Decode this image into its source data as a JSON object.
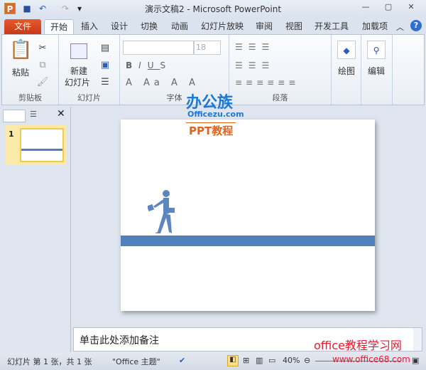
{
  "window": {
    "title": "演示文稿2 - Microsoft PowerPoint"
  },
  "quick_access": {
    "icons": [
      "powerpoint-icon",
      "save-icon",
      "undo-icon",
      "redo-icon",
      "customize-icon"
    ]
  },
  "tabs": [
    {
      "label": "文件"
    },
    {
      "label": "开始"
    },
    {
      "label": "插入"
    },
    {
      "label": "设计"
    },
    {
      "label": "切换"
    },
    {
      "label": "动画"
    },
    {
      "label": "幻灯片放映"
    },
    {
      "label": "审阅"
    },
    {
      "label": "视图"
    },
    {
      "label": "开发工具"
    },
    {
      "label": "加载项"
    }
  ],
  "ribbon": {
    "clipboard": {
      "label": "剪贴板",
      "paste": "粘贴"
    },
    "slides": {
      "label": "幻灯片",
      "new_line1": "新建",
      "new_line2": "幻灯片"
    },
    "font": {
      "label": "字体",
      "font_name": "",
      "font_size": "18"
    },
    "paragraph": {
      "label": "段落"
    },
    "drawing": {
      "label": "绘图"
    },
    "editing": {
      "label": "编辑"
    }
  },
  "slide_panel": {
    "slide_number": "1"
  },
  "watermarks": {
    "top_logo": "办公族",
    "top_site": "Officezu.com",
    "top_caption": "PPT教程",
    "bottom_logo": "office教程学习网",
    "bottom_site": "www.office68.com"
  },
  "colors": {
    "band": "#4f81bd",
    "file_tab": "#d9481f",
    "figure": "#5b86be"
  },
  "notes": {
    "placeholder": "单击此处添加备注"
  },
  "status": {
    "slide_info": "幻灯片 第 1 张，共 1 张",
    "theme": "\"Office 主题\"",
    "zoom": "40%"
  }
}
